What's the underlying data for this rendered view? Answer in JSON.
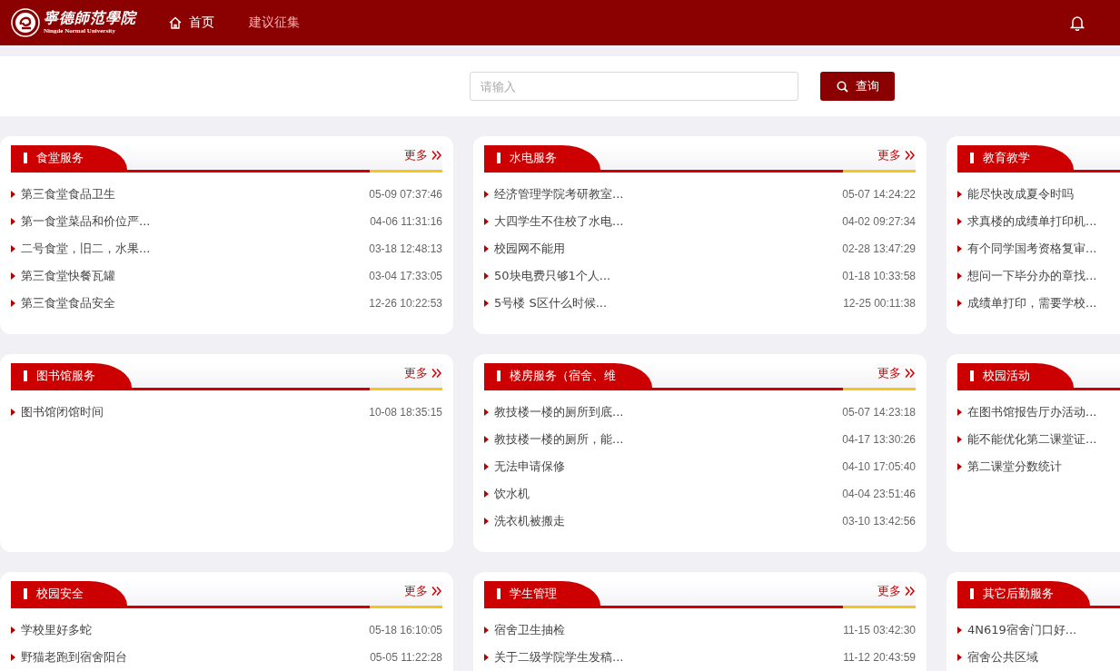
{
  "header": {
    "logo_cn": "寧德師范學院",
    "logo_en": "Ningde Normal University",
    "nav": [
      {
        "label": "首页",
        "selected": true,
        "kind": "home"
      },
      {
        "label": "建议征集",
        "selected": false
      }
    ]
  },
  "search": {
    "placeholder": "请输入",
    "button": "查询"
  },
  "sections": [
    {
      "title": "食堂服务",
      "more": "更多",
      "items": [
        {
          "text": "第三食堂食品卫生",
          "time": "05-09 07:37:46"
        },
        {
          "text": "第一食堂菜品和价位严...",
          "time": "04-06 11:31:16"
        },
        {
          "text": "二号食堂，旧二，水果...",
          "time": "03-18 12:48:13"
        },
        {
          "text": "第三食堂快餐瓦罐",
          "time": "03-04 17:33:05"
        },
        {
          "text": "第三食堂食品安全",
          "time": "12-26 10:22:53"
        }
      ]
    },
    {
      "title": "水电服务",
      "more": "更多",
      "items": [
        {
          "text": "经济管理学院考研教室...",
          "time": "05-07 14:24:22"
        },
        {
          "text": "大四学生不住校了水电...",
          "time": "04-02 09:27:34"
        },
        {
          "text": "校园网不能用",
          "time": "02-28 13:47:29"
        },
        {
          "text": "50块电费只够1个人...",
          "time": "01-18 10:33:58"
        },
        {
          "text": "5号楼 S区什么时候...",
          "time": "12-25 00:11:38"
        }
      ]
    },
    {
      "title": "教育教学",
      "items": [
        {
          "text": "能尽快改成夏令时吗"
        },
        {
          "text": "求真楼的成绩单打印机..."
        },
        {
          "text": "有个同学国考资格复审..."
        },
        {
          "text": "想问一下毕分办的章找..."
        },
        {
          "text": "成绩单打印，需要学校..."
        }
      ]
    },
    {
      "title": "图书馆服务",
      "more": "更多",
      "items": [
        {
          "text": "图书馆闭馆时间",
          "time": "10-08 18:35:15"
        }
      ]
    },
    {
      "title": "楼房服务（宿舍、维",
      "more": "更多",
      "items": [
        {
          "text": "教技楼一楼的厕所到底...",
          "time": "05-07 14:23:18"
        },
        {
          "text": "教技楼一楼的厕所，能...",
          "time": "04-17 13:30:26"
        },
        {
          "text": "无法申请保修",
          "time": "04-10 17:05:40"
        },
        {
          "text": "饮水机",
          "time": "04-04 23:51:46"
        },
        {
          "text": "洗衣机被搬走",
          "time": "03-10 13:42:56"
        }
      ]
    },
    {
      "title": "校园活动",
      "items": [
        {
          "text": "在图书馆报告厅办活动..."
        },
        {
          "text": "能不能优化第二课堂证..."
        },
        {
          "text": "第二课堂分数统计"
        }
      ]
    },
    {
      "title": "校园安全",
      "more": "更多",
      "items": [
        {
          "text": "学校里好多蛇",
          "time": "05-18 16:10:05"
        },
        {
          "text": "野猫老跑到宿舍阳台",
          "time": "05-05 11:22:28"
        }
      ]
    },
    {
      "title": "学生管理",
      "more": "更多",
      "items": [
        {
          "text": "宿舍卫生抽检",
          "time": "11-15 03:42:30"
        },
        {
          "text": "关于二级学院学生发稿...",
          "time": "11-12 20:43:59"
        }
      ]
    },
    {
      "title": "其它后勤服务",
      "items": [
        {
          "text": "4N619宿舍门口好..."
        },
        {
          "text": "宿舍公共区域"
        }
      ]
    }
  ]
}
